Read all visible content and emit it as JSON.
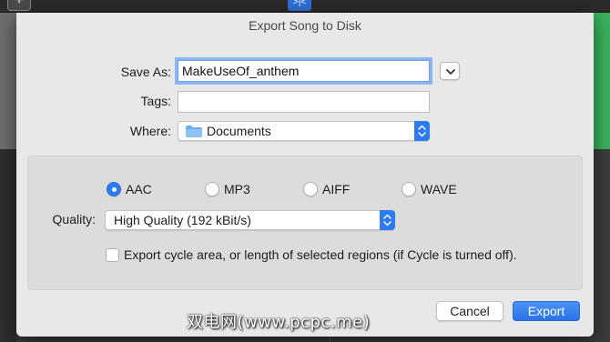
{
  "dialog": {
    "title": "Export Song to Disk",
    "save_as_label": "Save As:",
    "save_as_value": "MakeUseOf_anthem",
    "tags_label": "Tags:",
    "tags_value": "",
    "where_label": "Where:",
    "where_value": "Documents",
    "format_options": [
      {
        "label": "AAC",
        "selected": true
      },
      {
        "label": "MP3",
        "selected": false
      },
      {
        "label": "AIFF",
        "selected": false
      },
      {
        "label": "WAVE",
        "selected": false
      }
    ],
    "quality_label": "Quality:",
    "quality_value": "High Quality (192 kBit/s)",
    "cycle_checkbox_label": "Export cycle area, or length of selected regions (if Cycle is turned off).",
    "cycle_checkbox_checked": false,
    "cancel_label": "Cancel",
    "export_label": "Export"
  },
  "background": {
    "add_track_label": "+",
    "cycle_label": ">|<"
  },
  "watermark": "双电网(www.pcpc.me)",
  "colors": {
    "accent": "#2d7bf0",
    "dialog_bg": "#e8e8e8",
    "panel_bg": "#dcdcdc",
    "region_green": "#39b25b"
  },
  "icons": {
    "where_folder": "folder-icon",
    "expand": "chevron-down-icon",
    "popup_stepper": "up-down-arrows-icon"
  }
}
